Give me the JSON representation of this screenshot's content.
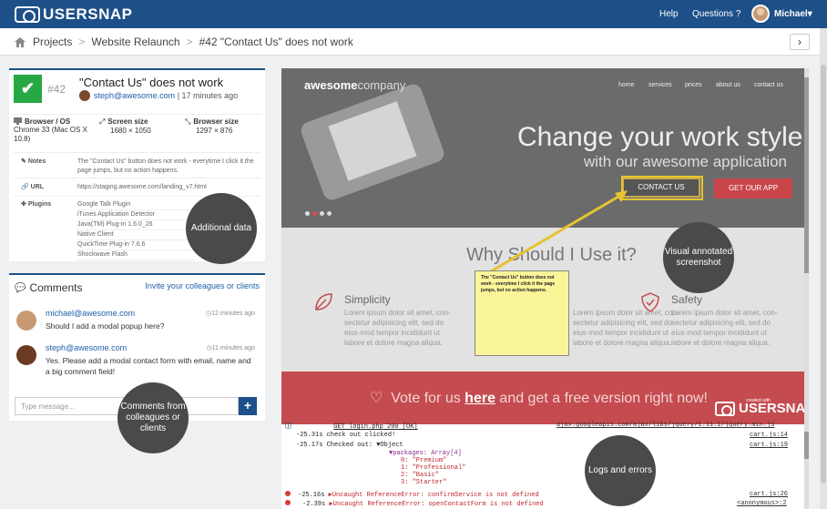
{
  "header": {
    "logo_text": "USERSNAP",
    "nav_help": "Help",
    "nav_questions": "Questions",
    "user_name": "Michael"
  },
  "breadcrumb": {
    "items": [
      "Projects",
      "Website Relaunch",
      "#42 \"Contact Us\" does not work"
    ],
    "next_label": "›"
  },
  "issue": {
    "number": "#42",
    "title": "\"Contact Us\" does not work",
    "reporter_email": "steph@awesome.com",
    "time_ago": "| 17 minutes ago",
    "browser_label": "Browser / OS",
    "browser_value": "Chrome 33 (Mac OS X 10.8)",
    "screen_label": "Screen size",
    "screen_value": "1680 × 1050",
    "bsize_label": "Browser size",
    "bsize_value": "1297 × 876",
    "notes_label": "Notes",
    "notes_value": "The \"Contact Us\" button does not work - everytime I click it the page jumps, but no action happens.",
    "url_label": "URL",
    "url_value": "https://staging.awesome.com/landing_v7.html",
    "plugins_label": "Plugins",
    "plugins": [
      "Google Talk Plugin",
      "iTunes Application Detector",
      "Java(TM) Plug-in 1.6.0_26",
      "Native Client",
      "QuickTime Plug-in 7.6.6",
      "Shockwave Flash"
    ]
  },
  "callouts": {
    "additional_data": "Additional data",
    "visual_screenshot": "Visual annotated screenshot",
    "comments_from": "Comments from colleagues or clients",
    "logs_errors": "Logs and errors"
  },
  "comments": {
    "header": "Comments",
    "invite": "Invite your colleagues or clients",
    "items": [
      {
        "email": "michael@awesome.com",
        "time": "12 minutes ago",
        "text": "Should I add a modal popup here?"
      },
      {
        "email": "steph@awesome.com",
        "time": "11 minutes ago",
        "text": "Yes. Please add a modal contact form with email, name and a big comment field!"
      }
    ],
    "input_placeholder": "Type message...",
    "send_label": "+"
  },
  "screenshot": {
    "brand_bold": "awesome",
    "brand_rest": "company",
    "nav": [
      "home",
      "services",
      "prices",
      "about us",
      "contact us"
    ],
    "hero_title": "Change your work style",
    "hero_sub": "with our awesome application",
    "contact_btn": "CONTACT US",
    "app_btn": "GET OUR APP",
    "why_title": "Why Should I Use it?",
    "features": [
      {
        "title": "Simplicity",
        "text": "Lorem ipsum dolor sit amet, con-sectetur adipisicing elit, sed do eius-mod tempor incididunt ut labore et dolore magna aliqua."
      },
      {
        "title": "",
        "text": "Lorem ipsum dolor sit amet, con-sectetur adipisicing elit, sed do eius-mod tempor incididunt ut labore et dolore magna aliqua."
      },
      {
        "title": "Safety",
        "text": "Lorem ipsum dolor sit amet, con-sectetur adipisicing elit, sed do eius-mod tempor incididunt ut labore et dolore magna aliqua."
      }
    ],
    "vote_pre": "Vote for us ",
    "vote_here": "here",
    "vote_post": " and get a free version right now!",
    "sticky_note": "The \"Contact Us\" button does not work - everytime I click it the page jumps, but no action happens.",
    "made_with": "created with",
    "made_brand": "USERSNAP"
  },
  "console": {
    "lines": [
      {
        "time": "",
        "text": "GET login.php 200 [OK]",
        "src": "ajax.googleapis.com/ajax/libs/jquery/1.11.1/jquery.min.js"
      },
      {
        "time": "-25.31s",
        "text": "check out clicked!",
        "src": "cart.js:14"
      },
      {
        "time": "-25.17s",
        "text": "Checked out: ▼Object",
        "src": "cart.js:19"
      },
      {
        "time": "",
        "text": "▼packages: Array[4]",
        "src": ""
      },
      {
        "time": "",
        "text": "0: \"Premium\"",
        "src": ""
      },
      {
        "time": "",
        "text": "1: \"Professional\"",
        "src": ""
      },
      {
        "time": "",
        "text": "2: \"Basic\"",
        "src": ""
      },
      {
        "time": "",
        "text": "3: \"Starter\"",
        "src": ""
      },
      {
        "time": "-25.16s",
        "text": "▶Uncaught ReferenceError: confirmService is not defined",
        "src": "cart.js:26"
      },
      {
        "time": "-2.39s",
        "text": "▶Uncaught ReferenceError: openContactForm is not defined",
        "src": "<anonymous>:2"
      }
    ]
  },
  "colors": {
    "brand_blue": "#1d4f88",
    "success_green": "#27a844",
    "accent_red": "#c44b4f",
    "sticky_yellow": "#fbf59a"
  }
}
